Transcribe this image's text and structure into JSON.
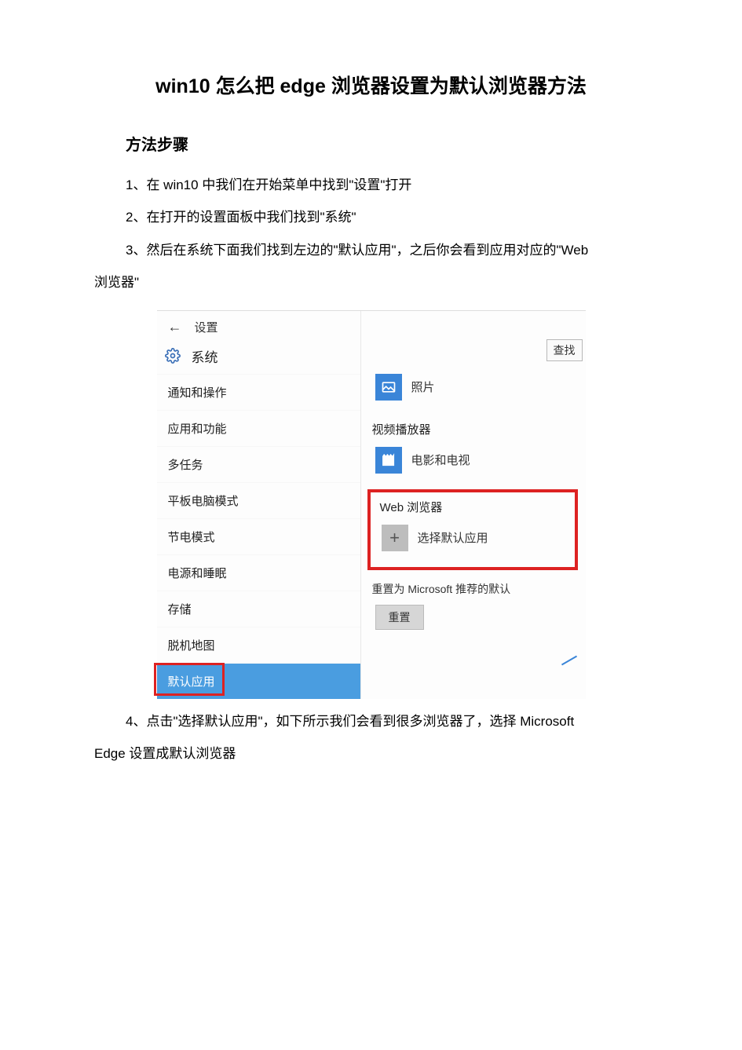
{
  "doc": {
    "title": "win10 怎么把 edge 浏览器设置为默认浏览器方法",
    "subtitle": "方法步骤",
    "step1": "1、在 win10 中我们在开始菜单中找到\"设置\"打开",
    "step2": "2、在打开的设置面板中我们找到\"系统\"",
    "step3a": "3、然后在系统下面我们找到左边的\"默认应用\"，之后你会看到应用对应的\"Web",
    "step3b": "浏览器\"",
    "step4a": "4、点击\"选择默认应用\"，如下所示我们会看到很多浏览器了，选择 Microsoft",
    "step4b": "Edge 设置成默认浏览器"
  },
  "screenshot": {
    "header": {
      "back": "←",
      "settings_label": "设置",
      "system_label": "系统",
      "search_btn": "查找"
    },
    "sidebar": [
      "通知和操作",
      "应用和功能",
      "多任务",
      "平板电脑模式",
      "节电模式",
      "电源和睡眠",
      "存储",
      "脱机地图",
      "默认应用"
    ],
    "right": {
      "photos_label": "照片",
      "video_section": "视频播放器",
      "movies_label": "电影和电视",
      "web_section": "Web 浏览器",
      "choose_default": "选择默认应用",
      "plus": "+",
      "reset_text": "重置为 Microsoft 推荐的默认",
      "reset_btn": "重置"
    }
  }
}
